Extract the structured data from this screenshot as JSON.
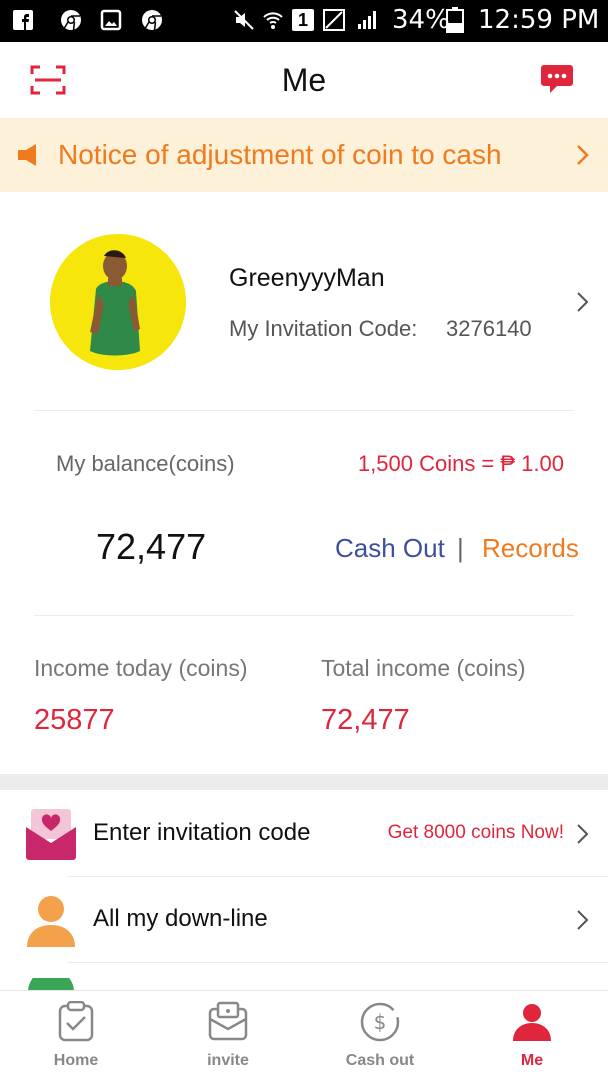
{
  "status_bar": {
    "battery": "34%",
    "time": "12:59 PM",
    "sim": "1",
    "icons": [
      "facebook-icon",
      "chrome-icon",
      "gallery-icon",
      "chrome-icon",
      "mute-icon",
      "wifi-icon",
      "sim-icon",
      "no-signal-icon",
      "signal-icon",
      "battery-icon"
    ]
  },
  "header": {
    "title": "Me",
    "left_icon": "scan-icon",
    "right_icon": "message-icon"
  },
  "notice": {
    "text": "Notice of adjustment of coin to cash"
  },
  "profile": {
    "username": "GreenyyyMan",
    "invite_label": "My Invitation Code:",
    "invite_code": "3276140"
  },
  "balance": {
    "label": "My balance(coins)",
    "rate": "1,500 Coins = ₱ 1.00",
    "value": "72,477",
    "cash_out": "Cash Out",
    "separator": "|",
    "records": "Records"
  },
  "income": {
    "today_label": "Income today (coins)",
    "today_value": "25877",
    "total_label": "Total income (coins)",
    "total_value": "72,477"
  },
  "list": [
    {
      "label": "Enter invitation code",
      "extra": "Get 8000 coins Now!"
    },
    {
      "label": "All my down-line",
      "extra": ""
    }
  ],
  "tabs": [
    {
      "label": "Home"
    },
    {
      "label": "invite"
    },
    {
      "label": "Cash out"
    },
    {
      "label": "Me"
    }
  ],
  "colors": {
    "accent_red": "#e0263c",
    "accent_orange": "#f07a1e",
    "link_blue": "#3f4f9e",
    "notice_bg": "#fdf1d9",
    "avatar_bg": "#f6e60c"
  }
}
